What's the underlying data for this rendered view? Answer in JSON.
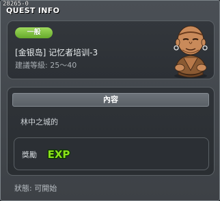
{
  "window": {
    "id_text": "28265-0",
    "title": "QUEST INFO"
  },
  "quest": {
    "category_badge": "一般",
    "name": "[金银岛] 记忆者培训-3",
    "level_range": "建議等級: 25～40",
    "npc_icon": "npc-portrait-old-monk"
  },
  "content": {
    "header": "內容",
    "text": "林中之城的",
    "reward_label": "獎勵",
    "reward_icon": "exp-icon",
    "reward_icon_text": "EXP"
  },
  "status": {
    "text": "狀態:  可開始"
  },
  "colors": {
    "badge_green": "#7cc23d",
    "exp_green": "#8be21a",
    "exp_outline": "#0b3600"
  }
}
